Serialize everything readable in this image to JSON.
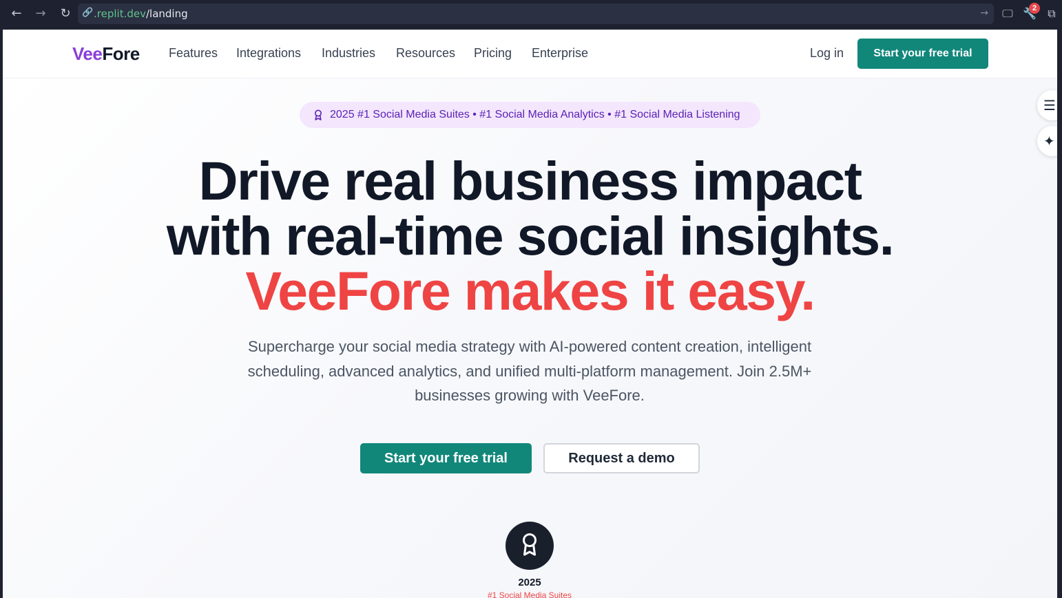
{
  "browser": {
    "url_domain": ".replit.dev",
    "url_path": "/landing",
    "notification_count": "2"
  },
  "header": {
    "logo_part1": "Vee",
    "logo_part2": "Fore",
    "nav": [
      "Features",
      "Integrations",
      "Industries",
      "Resources",
      "Pricing",
      "Enterprise"
    ],
    "login_label": "Log in",
    "cta_label": "Start your free trial"
  },
  "hero": {
    "award_pill": "2025 #1 Social Media Suites • #1 Social Media Analytics • #1 Social Media Listening",
    "headline_line1": "Drive real business impact",
    "headline_line2": "with real-time social insights.",
    "headline_line3": "VeeFore makes it easy.",
    "subtext": "Supercharge your social media strategy with AI-powered content creation, intelligent scheduling, advanced analytics, and unified multi-platform management. Join 2.5M+ businesses growing with VeeFore.",
    "primary_cta": "Start your free trial",
    "secondary_cta": "Request a demo"
  },
  "award": {
    "year": "2025",
    "label": "#1 Social Media Suites"
  },
  "colors": {
    "brand_purple": "#8b3fd9",
    "accent_teal": "#11877a",
    "accent_red": "#ef4444"
  }
}
